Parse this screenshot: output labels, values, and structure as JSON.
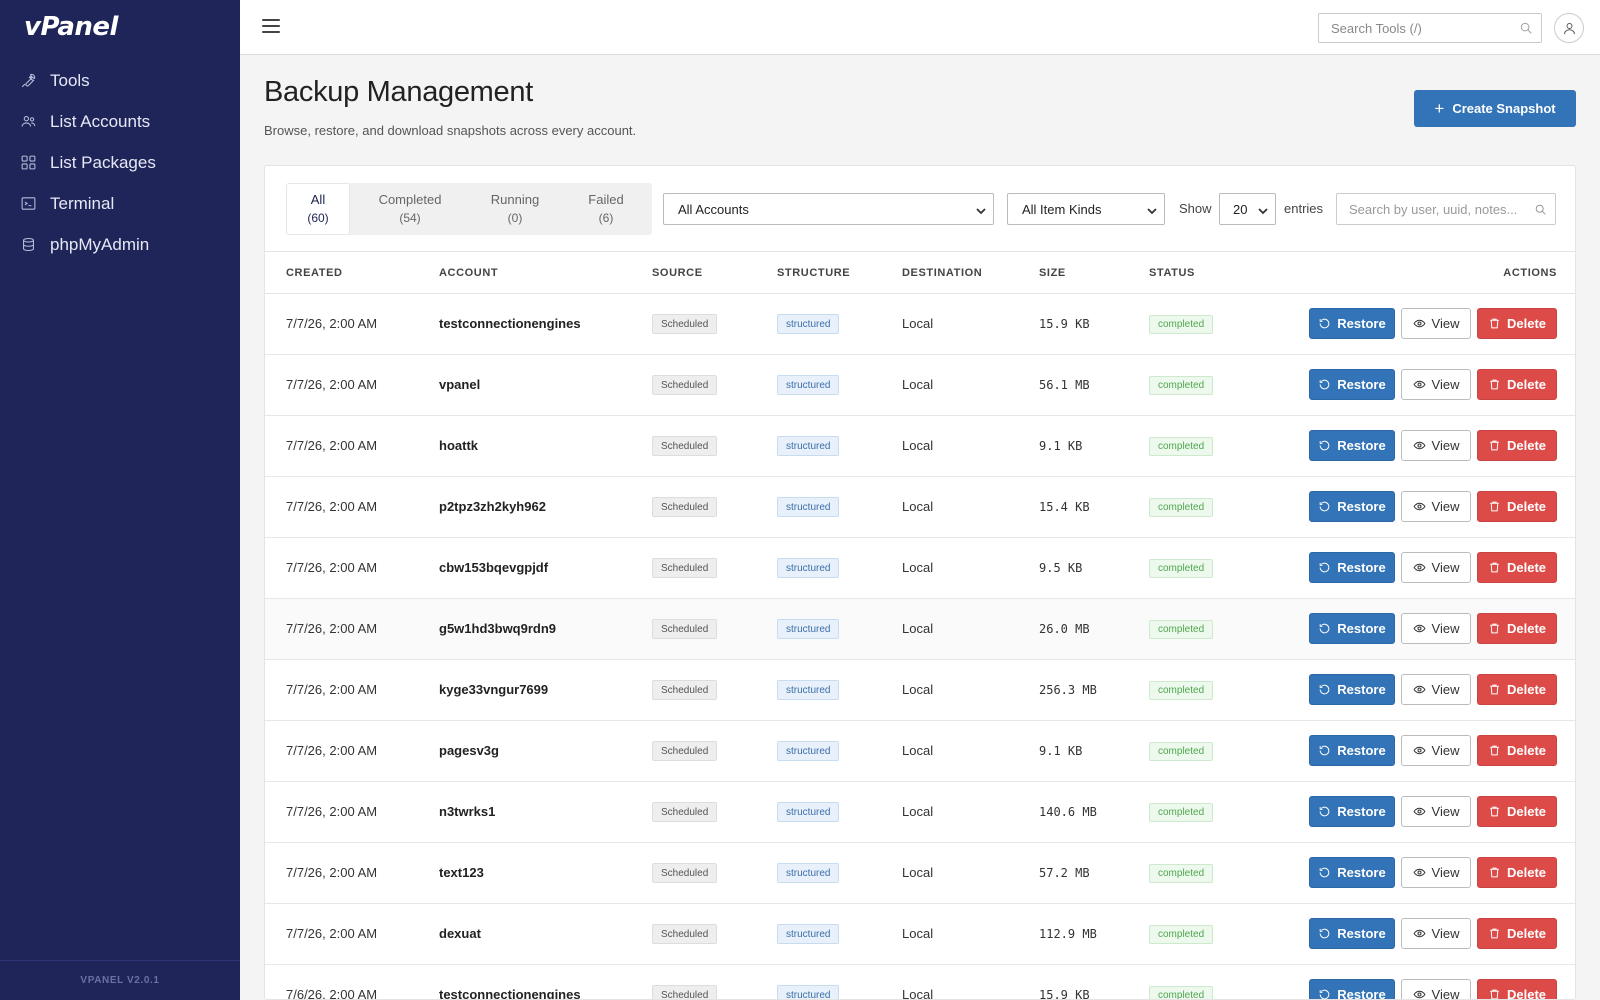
{
  "app": {
    "logo": "vPanel",
    "version": "VPANEL V2.0.1"
  },
  "sidebar": {
    "items": [
      {
        "label": "Tools",
        "icon": "wrench-icon"
      },
      {
        "label": "List Accounts",
        "icon": "users-icon"
      },
      {
        "label": "List Packages",
        "icon": "grid-icon"
      },
      {
        "label": "Terminal",
        "icon": "terminal-icon"
      },
      {
        "label": "phpMyAdmin",
        "icon": "database-icon"
      }
    ]
  },
  "topbar": {
    "search_placeholder": "Search Tools (/)"
  },
  "page": {
    "title": "Backup Management",
    "subtitle": "Browse, restore, and download snapshots across every account.",
    "create_label": "Create Snapshot"
  },
  "filters": {
    "tabs": [
      {
        "label": "All",
        "count": "(60)"
      },
      {
        "label": "Completed",
        "count": "(54)"
      },
      {
        "label": "Running",
        "count": "(0)"
      },
      {
        "label": "Failed",
        "count": "(6)"
      }
    ],
    "account_select": "All Accounts",
    "kind_select": "All Item Kinds",
    "show_label": "Show",
    "entries_value": "20",
    "entries_label": "entries",
    "search_placeholder": "Search by user, uuid, notes..."
  },
  "table": {
    "headers": {
      "created": "CREATED",
      "account": "ACCOUNT",
      "source": "SOURCE",
      "structure": "STRUCTURE",
      "destination": "DESTINATION",
      "size": "SIZE",
      "status": "STATUS",
      "actions": "ACTIONS"
    },
    "actions": {
      "restore": "Restore",
      "view": "View",
      "delete": "Delete"
    },
    "rows": [
      {
        "created": "7/7/26, 2:00 AM",
        "account": "testconnectionengines",
        "source": "Scheduled",
        "structure": "structured",
        "destination": "Local",
        "size": "15.9 KB",
        "status": "completed"
      },
      {
        "created": "7/7/26, 2:00 AM",
        "account": "vpanel",
        "source": "Scheduled",
        "structure": "structured",
        "destination": "Local",
        "size": "56.1 MB",
        "status": "completed"
      },
      {
        "created": "7/7/26, 2:00 AM",
        "account": "hoattk",
        "source": "Scheduled",
        "structure": "structured",
        "destination": "Local",
        "size": "9.1 KB",
        "status": "completed"
      },
      {
        "created": "7/7/26, 2:00 AM",
        "account": "p2tpz3zh2kyh962",
        "source": "Scheduled",
        "structure": "structured",
        "destination": "Local",
        "size": "15.4 KB",
        "status": "completed"
      },
      {
        "created": "7/7/26, 2:00 AM",
        "account": "cbw153bqevgpjdf",
        "source": "Scheduled",
        "structure": "structured",
        "destination": "Local",
        "size": "9.5 KB",
        "status": "completed"
      },
      {
        "created": "7/7/26, 2:00 AM",
        "account": "g5w1hd3bwq9rdn9",
        "source": "Scheduled",
        "structure": "structured",
        "destination": "Local",
        "size": "26.0 MB",
        "status": "completed"
      },
      {
        "created": "7/7/26, 2:00 AM",
        "account": "kyge33vngur7699",
        "source": "Scheduled",
        "structure": "structured",
        "destination": "Local",
        "size": "256.3 MB",
        "status": "completed"
      },
      {
        "created": "7/7/26, 2:00 AM",
        "account": "pagesv3g",
        "source": "Scheduled",
        "structure": "structured",
        "destination": "Local",
        "size": "9.1 KB",
        "status": "completed"
      },
      {
        "created": "7/7/26, 2:00 AM",
        "account": "n3twrks1",
        "source": "Scheduled",
        "structure": "structured",
        "destination": "Local",
        "size": "140.6 MB",
        "status": "completed"
      },
      {
        "created": "7/7/26, 2:00 AM",
        "account": "text123",
        "source": "Scheduled",
        "structure": "structured",
        "destination": "Local",
        "size": "57.2 MB",
        "status": "completed"
      },
      {
        "created": "7/7/26, 2:00 AM",
        "account": "dexuat",
        "source": "Scheduled",
        "structure": "structured",
        "destination": "Local",
        "size": "112.9 MB",
        "status": "completed"
      },
      {
        "created": "7/6/26, 2:00 AM",
        "account": "testconnectionengines",
        "source": "Scheduled",
        "structure": "structured",
        "destination": "Local",
        "size": "15.9 KB",
        "status": "completed"
      }
    ]
  },
  "colors": {
    "sidebar": "#1f2559",
    "primary": "#3374b8",
    "danger": "#dd4b48",
    "success": "#4ea64e"
  }
}
